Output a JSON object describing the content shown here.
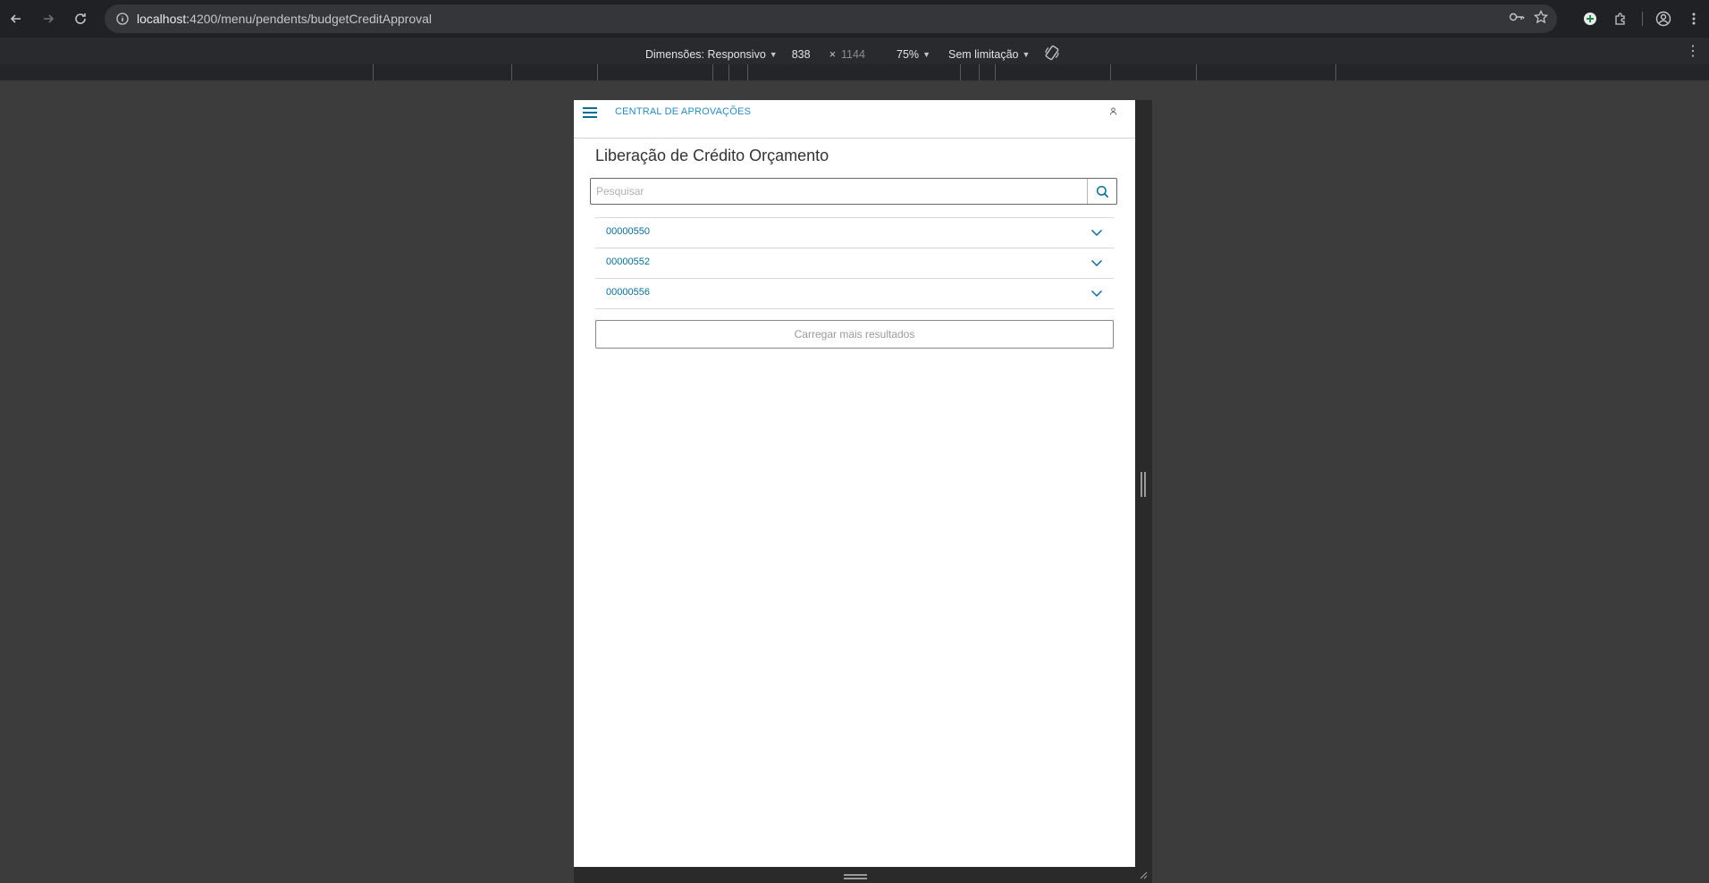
{
  "browser": {
    "url_host": "localhost:",
    "url_port_path": "4200/menu/pendents/budgetCreditApproval"
  },
  "devtools": {
    "dimensions_label": "Dimensões: Responsivo",
    "width_value": "838",
    "times": "×",
    "height_value": "1144",
    "zoom": "75%",
    "throttle": "Sem limitação"
  },
  "app": {
    "header_title": "CENTRAL DE APROVAÇÕES",
    "page_title": "Liberação de Crédito Orçamento",
    "search_placeholder": "Pesquisar",
    "items": [
      {
        "code": "00000550"
      },
      {
        "code": "00000552"
      },
      {
        "code": "00000556"
      }
    ],
    "load_more_label": "Carregar mais resultados"
  },
  "colors": {
    "accent": "#0c6c94",
    "title_link": "#2a89b8"
  }
}
